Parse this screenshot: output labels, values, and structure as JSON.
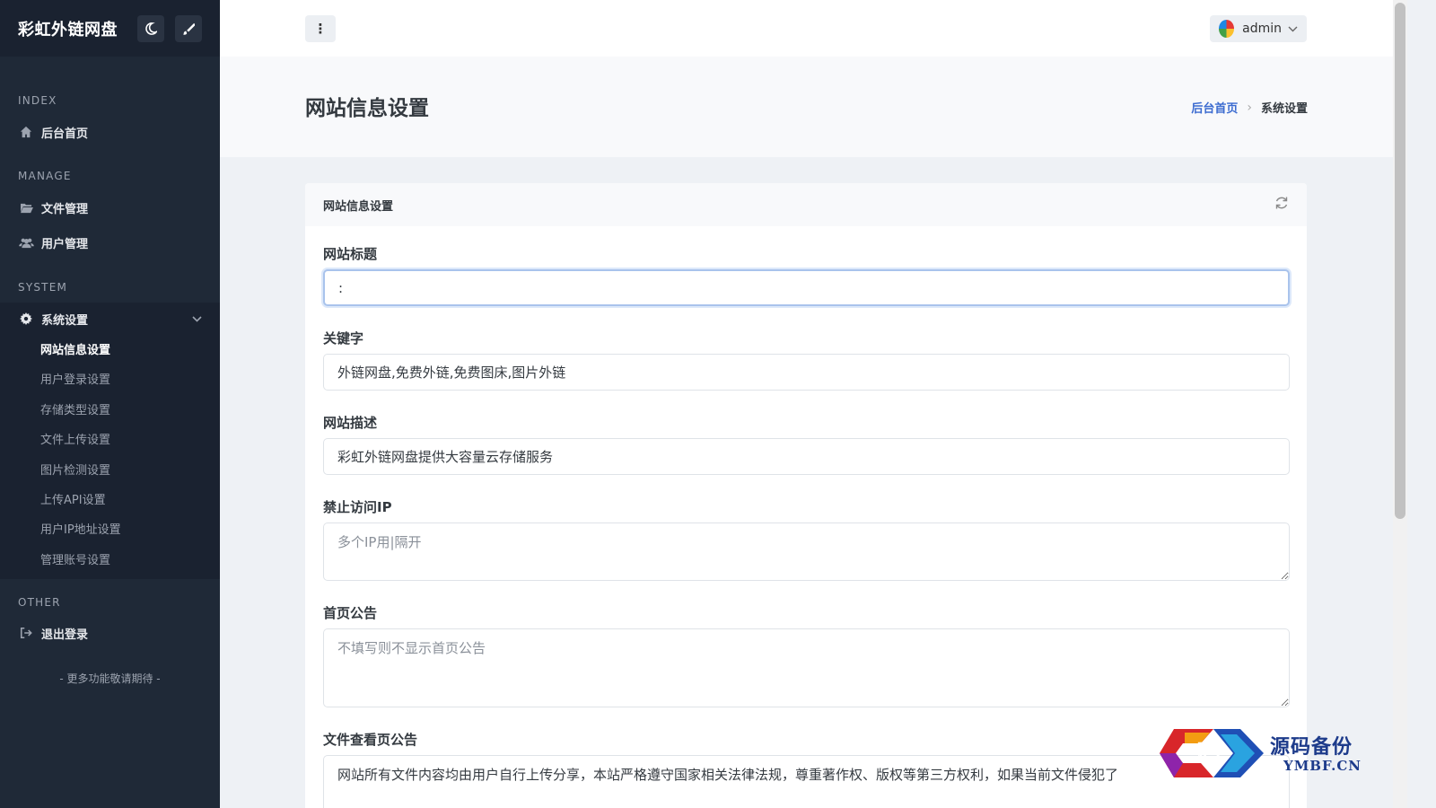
{
  "sidebar": {
    "brand": "彩虹外链网盘",
    "sections": {
      "index": "INDEX",
      "manage": "MANAGE",
      "system": "SYSTEM",
      "other": "OTHER"
    },
    "items": {
      "home": "后台首页",
      "files": "文件管理",
      "users": "用户管理",
      "settings": "系统设置",
      "logout": "退出登录"
    },
    "submenu": [
      "网站信息设置",
      "用户登录设置",
      "存储类型设置",
      "文件上传设置",
      "图片检测设置",
      "上传API设置",
      "用户IP地址设置",
      "管理账号设置"
    ],
    "footer": "- 更多功能敬请期待 -"
  },
  "topbar": {
    "username": "admin"
  },
  "page": {
    "title": "网站信息设置",
    "breadcrumb_home": "后台首页",
    "breadcrumb_current": "系统设置"
  },
  "card": {
    "title": "网站信息设置",
    "fields": {
      "site_title_label": "网站标题",
      "site_title_value": ":",
      "keywords_label": "关键字",
      "keywords_value": "外链网盘,免费外链,免费图床,图片外链",
      "description_label": "网站描述",
      "description_value": "彩虹外链网盘提供大容量云存储服务",
      "blocked_ip_label": "禁止访问IP",
      "blocked_ip_placeholder": "多个IP用|隔开",
      "home_notice_label": "首页公告",
      "home_notice_placeholder": "不填写则不显示首页公告",
      "file_notice_label": "文件查看页公告",
      "file_notice_value": "网站所有文件内容均由用户自行上传分享，本站严格遵守国家相关法律法规，尊重著作权、版权等第三方权利，如果当前文件侵犯了"
    }
  },
  "watermark": {
    "title": "源码备份",
    "subtitle": "YMBF.CN"
  },
  "colors": {
    "sidebar_bg": "#1f2937",
    "accent_link": "#3b6bd0",
    "focus_border": "#a9c3ec"
  }
}
